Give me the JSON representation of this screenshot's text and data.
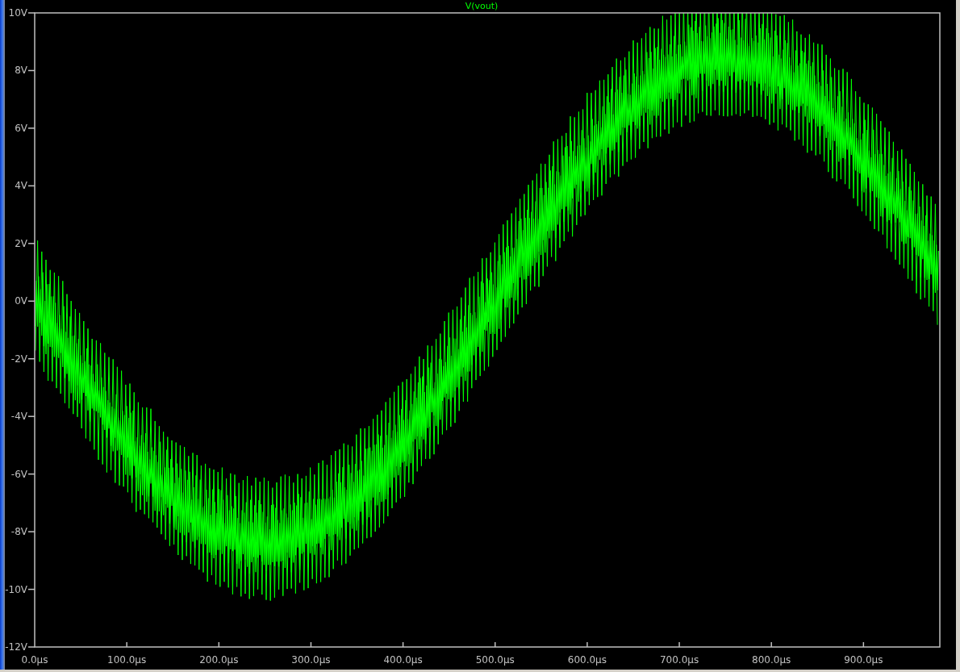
{
  "plot": {
    "title": "V(vout)",
    "y_tick_labels": [
      "10V",
      "8V",
      "6V",
      "4V",
      "2V",
      "0V",
      "-2V",
      "-4V",
      "-6V",
      "-8V",
      "-10V",
      "-12V"
    ],
    "x_tick_labels": [
      "0.0µs",
      "100.0µs",
      "200.0µs",
      "300.0µs",
      "400.0µs",
      "500.0µs",
      "600.0µs",
      "700.0µs",
      "800.0µs",
      "900.0µs"
    ]
  }
}
